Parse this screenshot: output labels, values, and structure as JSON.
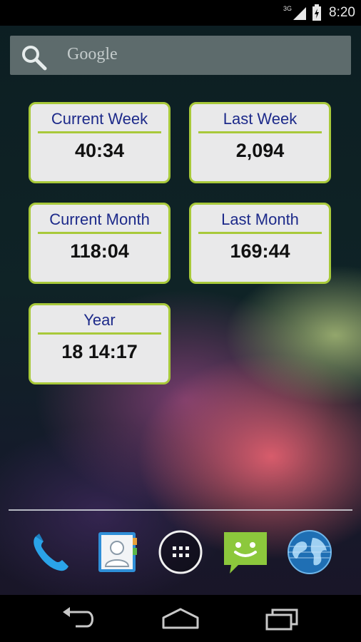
{
  "status_bar": {
    "network_type": "3G",
    "time": "8:20",
    "icons": [
      "signal-icon",
      "battery-icon"
    ]
  },
  "search": {
    "placeholder": "Google",
    "icon": "search-icon"
  },
  "widgets": [
    {
      "label": "Current Week",
      "value": "40:34"
    },
    {
      "label": "Last Week",
      "value": "2,094"
    },
    {
      "label": "Current Month",
      "value": "118:04"
    },
    {
      "label": "Last Month",
      "value": "169:44"
    },
    {
      "label": "Year",
      "value": "18 14:17"
    }
  ],
  "dock": {
    "apps": [
      "phone-icon",
      "contacts-icon",
      "app-drawer-icon",
      "messaging-icon",
      "browser-icon"
    ]
  },
  "nav_bar": {
    "buttons": [
      "back-icon",
      "home-icon",
      "recent-apps-icon"
    ]
  },
  "colors": {
    "widget_border": "#a8c93a",
    "widget_label": "#1d2a8a",
    "widget_bg": "#e9e9ea"
  }
}
